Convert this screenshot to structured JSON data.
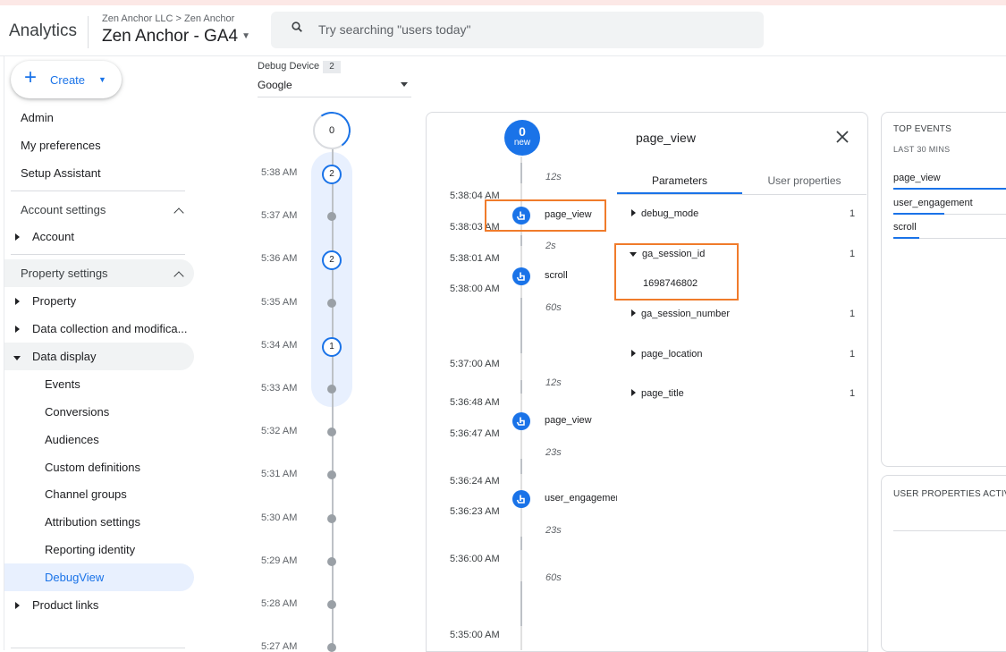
{
  "header": {
    "app_name": "Analytics",
    "breadcrumb": "Zen Anchor LLC > Zen Anchor",
    "property_name": "Zen Anchor - GA4",
    "search_placeholder": "Try searching \"users today\""
  },
  "sidebar": {
    "create_label": "Create",
    "items": [
      {
        "label": "Admin"
      },
      {
        "label": "My preferences"
      },
      {
        "label": "Setup Assistant"
      },
      {
        "label": "Account settings"
      },
      {
        "label": "Account"
      },
      {
        "label": "Property settings"
      },
      {
        "label": "Property"
      },
      {
        "label": "Data collection and modifica..."
      },
      {
        "label": "Data display"
      },
      {
        "label": "Events"
      },
      {
        "label": "Conversions"
      },
      {
        "label": "Audiences"
      },
      {
        "label": "Custom definitions"
      },
      {
        "label": "Channel groups"
      },
      {
        "label": "Attribution settings"
      },
      {
        "label": "Reporting identity"
      },
      {
        "label": "DebugView"
      },
      {
        "label": "Product links"
      }
    ]
  },
  "device": {
    "label": "Debug Device",
    "count": "2",
    "selected": "Google"
  },
  "minutes": {
    "top_count": "0",
    "rows": [
      {
        "time": "5:38 AM",
        "count": "2"
      },
      {
        "time": "5:37 AM",
        "count": ""
      },
      {
        "time": "5:36 AM",
        "count": "2"
      },
      {
        "time": "5:35 AM",
        "count": ""
      },
      {
        "time": "5:34 AM",
        "count": "1"
      },
      {
        "time": "5:33 AM",
        "count": ""
      },
      {
        "time": "5:32 AM",
        "count": ""
      },
      {
        "time": "5:31 AM",
        "count": ""
      },
      {
        "time": "5:30 AM",
        "count": ""
      },
      {
        "time": "5:29 AM",
        "count": ""
      },
      {
        "time": "5:28 AM",
        "count": ""
      },
      {
        "time": "5:27 AM",
        "count": ""
      }
    ]
  },
  "seconds": {
    "new_count": "0",
    "new_label": "new",
    "times": [
      "5:38:04 AM",
      "5:38:03 AM",
      "5:38:01 AM",
      "5:38:00 AM",
      "5:37:00 AM",
      "5:36:48 AM",
      "5:36:47 AM",
      "5:36:24 AM",
      "5:36:23 AM",
      "5:36:00 AM",
      "5:35:00 AM"
    ],
    "gaps": [
      "12s",
      "2s",
      "60s",
      "12s",
      "23s",
      "23s",
      "60s"
    ],
    "events": [
      "page_view",
      "scroll",
      "page_view",
      "user_engagement"
    ]
  },
  "params": {
    "title": "page_view",
    "tabs": [
      "Parameters",
      "User properties"
    ],
    "rows": [
      {
        "name": "debug_mode",
        "count": "1"
      },
      {
        "name": "ga_session_id",
        "count": "1",
        "value": "1698746802"
      },
      {
        "name": "ga_session_number",
        "count": "1"
      },
      {
        "name": "page_location",
        "count": "1"
      },
      {
        "name": "page_title",
        "count": "1"
      }
    ]
  },
  "top_events": {
    "title": "TOP EVENTS",
    "subtitle": "LAST 30 MINS",
    "items": [
      {
        "name": "page_view",
        "share": 1.0
      },
      {
        "name": "user_engagement",
        "share": 0.45
      },
      {
        "name": "scroll",
        "share": 0.23
      }
    ]
  },
  "user_props": {
    "title": "USER PROPERTIES ACTIVE"
  },
  "colors": {
    "accent": "#1a73e8",
    "highlight": "#f07b2b"
  }
}
